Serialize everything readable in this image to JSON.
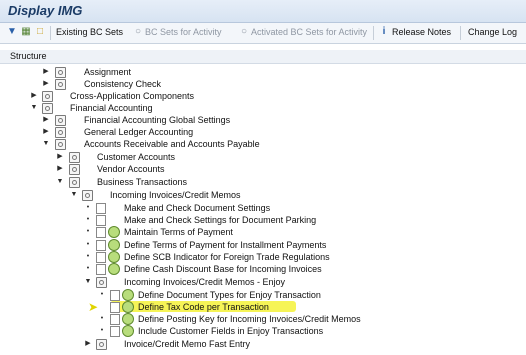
{
  "window": {
    "title": "Display IMG"
  },
  "toolbar": {
    "existing_bc_sets": "Existing BC Sets",
    "bc_sets_for_activity": "BC Sets for Activity",
    "activated_bc_sets": "Activated BC Sets for Activity",
    "release_notes": "Release Notes",
    "change_log": "Change Log"
  },
  "structure": {
    "header": "Structure"
  },
  "tree": {
    "assignment": "Assignment",
    "consistency_check": "Consistency Check",
    "cross_application": "Cross-Application Components",
    "financial_accounting": "Financial Accounting",
    "fa_global_settings": "Financial Accounting Global Settings",
    "gl_accounting": "General Ledger Accounting",
    "ar_ap": "Accounts Receivable and Accounts Payable",
    "customer_accounts": "Customer Accounts",
    "vendor_accounts": "Vendor Accounts",
    "business_transactions": "Business Transactions",
    "incoming_invoices": "Incoming Invoices/Credit Memos",
    "make_check_doc_settings": "Make and Check Document Settings",
    "make_check_parking": "Make and Check Settings for Document Parking",
    "maintain_terms": "Maintain Terms of Payment",
    "define_terms_installment": "Define Terms of Payment for Installment Payments",
    "define_scb": "Define SCB Indicator for Foreign Trade Regulations",
    "define_cash_discount": "Define Cash Discount Base for Incoming Invoices",
    "incoming_enjoy": "Incoming Invoices/Credit Memos - Enjoy",
    "define_doc_types": "Define Document Types for Enjoy Transaction",
    "define_tax_code": "Define Tax Code per Transaction",
    "define_posting_key": "Define Posting Key for Incoming Invoices/Credit Memos",
    "include_customer_fields": "Include Customer Fields in Enjoy Transactions",
    "invoice_fast_entry": "Invoice/Credit Memo Fast Entry"
  },
  "colors": {
    "highlight": "#f5f23a",
    "title": "#1b3b66"
  }
}
